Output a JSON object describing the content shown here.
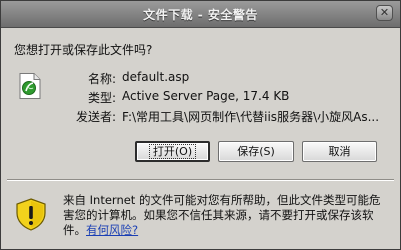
{
  "window": {
    "title": "文件下载 - 安全警告",
    "close_symbol": "✕"
  },
  "dialog": {
    "question": "您想打开或保存此文件吗?",
    "name_label": "名称:",
    "name_value": "default.asp",
    "type_label": "类型:",
    "type_value": "Active Server Page, 17.4 KB",
    "from_label": "发送者:",
    "from_value": "F:\\常用工具\\网页制作\\代替iis服务器\\小旋风As..."
  },
  "buttons": {
    "open": "打开(O)",
    "save": "保存(S)",
    "cancel": "取消"
  },
  "warning": {
    "text": "来自 Internet 的文件可能对您有所帮助，但此文件类型可能危害您的计算机。如果您不信任其来源，请不要打开或保存该软件。",
    "link": "有何风险?"
  },
  "icons": {
    "file": "asp-file-icon",
    "warning": "shield-warning-icon"
  },
  "colors": {
    "titlebar": "#7f7f7f",
    "dialog_bg": "#d4d2cd",
    "link": "#1a3fb4",
    "shield_yellow": "#f2d21c"
  }
}
